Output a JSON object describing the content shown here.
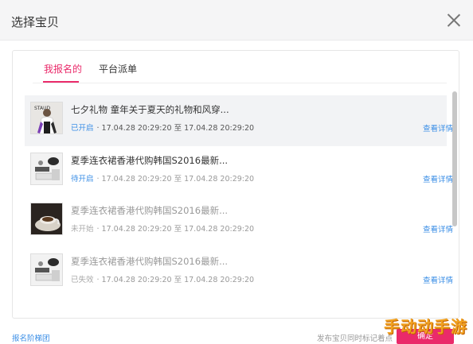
{
  "dialog": {
    "title": "选择宝贝"
  },
  "tabs": [
    {
      "label": "我报名的",
      "active": true
    },
    {
      "label": "平台派单",
      "active": false
    }
  ],
  "items": [
    {
      "title": "七夕礼物 童年关于夏天的礼物和风穿...",
      "status": "已开启",
      "status_color": "#3a8ee6",
      "range": "· 17.04.28  20:29:20 至 17.04.28  20:29:20",
      "detail": "查看详情",
      "thumb": "person-photo"
    },
    {
      "title": "夏季连衣裙香港代购韩国S2016最新...",
      "status": "待开启",
      "status_color": "#3a8ee6",
      "range": "· 17.04.28  20:29:20 至 17.04.28  20:29:20",
      "detail": "查看详情",
      "thumb": "product-photo"
    },
    {
      "title": "夏季连衣裙香港代购韩国S2016最新...",
      "status": "未开始",
      "status_color": "#aaaaaa",
      "range": "· 17.04.28  20:29:20 至 17.04.28  20:29:20",
      "detail": "查看详情",
      "thumb": "coffee-photo"
    },
    {
      "title": "夏季连衣裙香港代购韩国S2016最新...",
      "status": "已失效",
      "status_color": "#aaaaaa",
      "range": "· 17.04.28  20:29:20 至 17.04.28  20:29:20",
      "detail": "查看详情",
      "thumb": "product-photo"
    }
  ],
  "footer": {
    "link": "报名阶梯团",
    "note": "发布宝贝同时标记着点",
    "button": "确定"
  },
  "watermark": "手动动手游",
  "colors": {
    "accent": "#ea2a6a",
    "link": "#3a8ee6"
  }
}
